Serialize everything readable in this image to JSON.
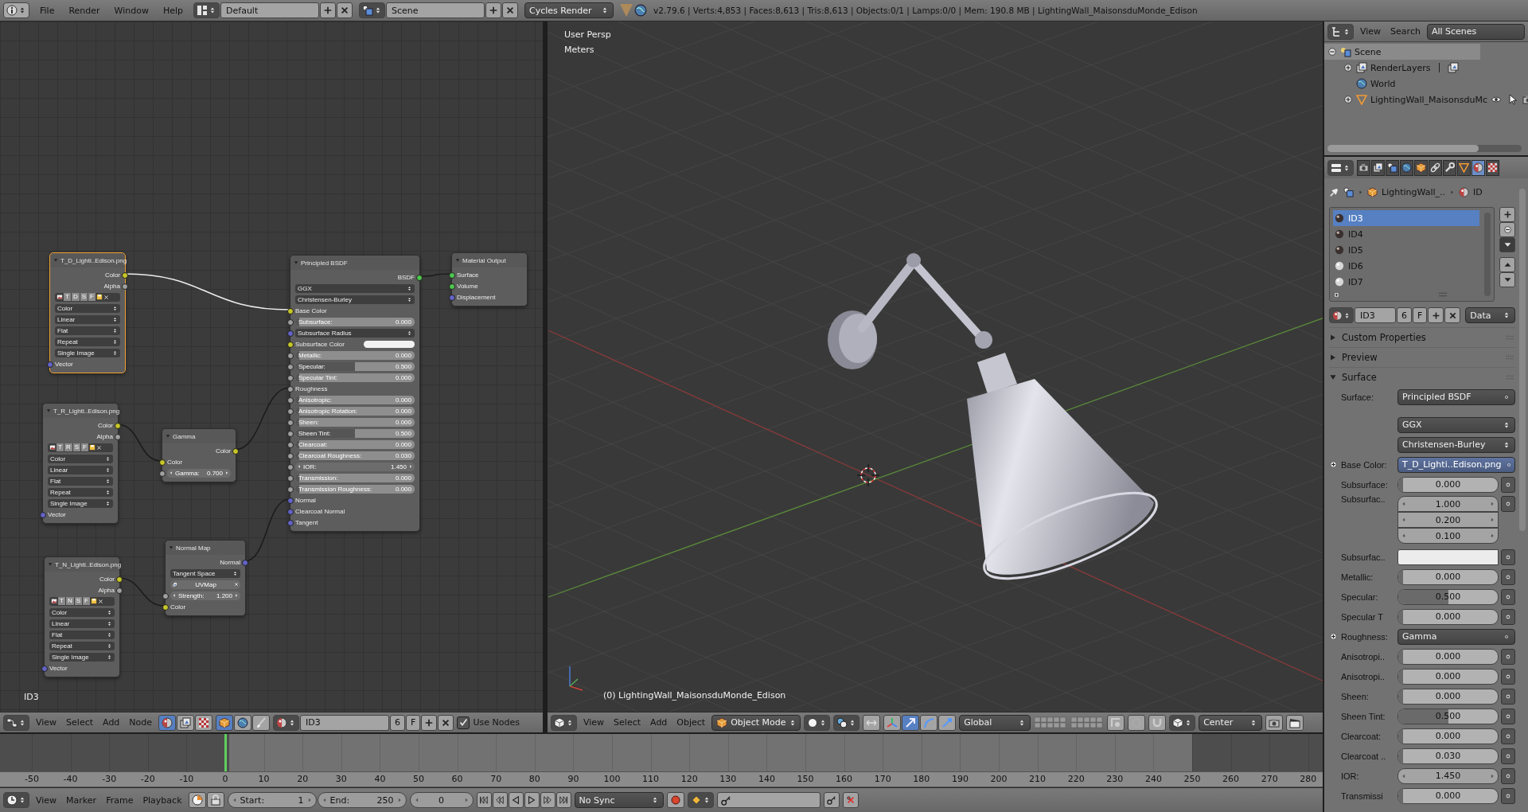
{
  "top_bar": {
    "menus": [
      "File",
      "Render",
      "Window",
      "Help"
    ],
    "screen_layout": "Default",
    "scene": "Scene",
    "engine": "Cycles Render",
    "stats": "v2.79.6 | Verts:4,853 | Faces:8,613 | Tris:8,613 | Objects:0/1 | Lamps:0/0 | Mem: 190.8 MB | LightingWall_MaisonsduMonde_Edison"
  },
  "node_editor": {
    "material_label": "ID3",
    "nodes": [
      {
        "title": "T_D_Lighti..Edison.png",
        "selected": true,
        "rows": [
          {
            "kind": "output",
            "label": "Color",
            "color": "#c7c729"
          },
          {
            "kind": "output",
            "label": "Alpha",
            "color": "#a1a1a1"
          },
          {
            "kind": "image_buttons",
            "letters": [
              "T",
              "D",
              "S",
              "F"
            ]
          },
          {
            "kind": "dropdown",
            "value": "Color"
          },
          {
            "kind": "dropdown",
            "value": "Linear"
          },
          {
            "kind": "dropdown",
            "value": "Flat"
          },
          {
            "kind": "dropdown",
            "value": "Repeat"
          },
          {
            "kind": "dropdown",
            "value": "Single Image"
          },
          {
            "kind": "input",
            "label": "Vector",
            "color": "#6363c7"
          }
        ]
      },
      {
        "title": "T_R_Lighti..Edison.png",
        "selected": false,
        "rows": [
          {
            "kind": "output",
            "label": "Color",
            "color": "#c7c729"
          },
          {
            "kind": "output",
            "label": "Alpha",
            "color": "#a1a1a1"
          },
          {
            "kind": "image_buttons",
            "letters": [
              "T",
              "R",
              "S",
              "F"
            ]
          },
          {
            "kind": "dropdown",
            "value": "Color"
          },
          {
            "kind": "dropdown",
            "value": "Linear"
          },
          {
            "kind": "dropdown",
            "value": "Flat"
          },
          {
            "kind": "dropdown",
            "value": "Repeat"
          },
          {
            "kind": "dropdown",
            "value": "Single Image"
          },
          {
            "kind": "input",
            "label": "Vector",
            "color": "#6363c7"
          }
        ]
      },
      {
        "title": "T_N_Lighti..Edison.png",
        "selected": false,
        "rows": [
          {
            "kind": "output",
            "label": "Color",
            "color": "#c7c729"
          },
          {
            "kind": "output",
            "label": "Alpha",
            "color": "#a1a1a1"
          },
          {
            "kind": "image_buttons",
            "letters": [
              "T",
              "N",
              "S",
              "F"
            ]
          },
          {
            "kind": "dropdown",
            "value": "Color"
          },
          {
            "kind": "dropdown",
            "value": "Linear"
          },
          {
            "kind": "dropdown",
            "value": "Flat"
          },
          {
            "kind": "dropdown",
            "value": "Repeat"
          },
          {
            "kind": "dropdown",
            "value": "Single Image"
          },
          {
            "kind": "input",
            "label": "Vector",
            "color": "#6363c7"
          }
        ]
      },
      {
        "title": "Gamma",
        "selected": false,
        "rows": [
          {
            "kind": "output",
            "label": "Color",
            "color": "#c7c729"
          },
          {
            "kind": "input",
            "label": "Color",
            "color": "#c7c729"
          },
          {
            "kind": "number",
            "label": "Gamma:",
            "value": "0.700",
            "color": "#a1a1a1"
          }
        ]
      },
      {
        "title": "Normal Map",
        "selected": false,
        "rows": [
          {
            "kind": "output",
            "label": "Normal",
            "color": "#6363c7"
          },
          {
            "kind": "dropdown",
            "value": "Tangent Space"
          },
          {
            "kind": "field",
            "value": "UVMap"
          },
          {
            "kind": "number",
            "label": "Strength:",
            "value": "1.200",
            "color": "#a1a1a1"
          },
          {
            "kind": "input",
            "label": "Color",
            "color": "#c7c729"
          }
        ]
      },
      {
        "title": "Principled BSDF",
        "selected": false,
        "rows": [
          {
            "kind": "output",
            "label": "BSDF",
            "color": "#4fc74f"
          },
          {
            "kind": "dropdown",
            "value": "GGX"
          },
          {
            "kind": "dropdown",
            "value": "Christensen-Burley"
          },
          {
            "kind": "input",
            "label": "Base Color",
            "color": "#c7c729"
          },
          {
            "kind": "slider",
            "label": "Subsurface:",
            "value": "0.000",
            "level": 0,
            "color": "#a1a1a1"
          },
          {
            "kind": "dropdown",
            "value": "Subsurface Radius",
            "color": "#6363c7"
          },
          {
            "kind": "color",
            "label": "Subsurface Color",
            "color": "#c7c729"
          },
          {
            "kind": "slider",
            "label": "Metallic:",
            "value": "0.000",
            "level": 0,
            "color": "#a1a1a1"
          },
          {
            "kind": "slider",
            "label": "Specular:",
            "value": "0.500",
            "level": 0.5,
            "color": "#a1a1a1"
          },
          {
            "kind": "slider",
            "label": "Specular Tint:",
            "value": "0.000",
            "level": 0,
            "color": "#a1a1a1"
          },
          {
            "kind": "input",
            "label": "Roughness",
            "color": "#a1a1a1"
          },
          {
            "kind": "slider",
            "label": "Anisotropic:",
            "value": "0.000",
            "level": 0,
            "color": "#a1a1a1"
          },
          {
            "kind": "slider",
            "label": "Anisotropic Rotation:",
            "value": "0.000",
            "level": 0,
            "color": "#a1a1a1"
          },
          {
            "kind": "slider",
            "label": "Sheen:",
            "value": "0.000",
            "level": 0,
            "color": "#a1a1a1"
          },
          {
            "kind": "slider",
            "label": "Sheen Tint:",
            "value": "0.500",
            "level": 0.5,
            "color": "#a1a1a1"
          },
          {
            "kind": "slider",
            "label": "Clearcoat:",
            "value": "0.000",
            "level": 0,
            "color": "#a1a1a1"
          },
          {
            "kind": "slider",
            "label": "Clearcoat Roughness:",
            "value": "0.030",
            "level": 0.03,
            "color": "#a1a1a1"
          },
          {
            "kind": "number",
            "label": "IOR:",
            "value": "1.450",
            "color": "#a1a1a1"
          },
          {
            "kind": "slider",
            "label": "Transmission:",
            "value": "0.000",
            "level": 0,
            "color": "#a1a1a1"
          },
          {
            "kind": "slider",
            "label": "Transmission Roughness:",
            "value": "0.000",
            "level": 0,
            "color": "#a1a1a1"
          },
          {
            "kind": "input",
            "label": "Normal",
            "color": "#6363c7"
          },
          {
            "kind": "input",
            "label": "Clearcoat Normal",
            "color": "#6363c7"
          },
          {
            "kind": "input",
            "label": "Tangent",
            "color": "#6363c7"
          }
        ]
      },
      {
        "title": "Material Output",
        "selected": false,
        "rows": [
          {
            "kind": "input",
            "label": "Surface",
            "color": "#4fc74f"
          },
          {
            "kind": "input",
            "label": "Volume",
            "color": "#4fc74f"
          },
          {
            "kind": "input",
            "label": "Displacement",
            "color": "#6363c7"
          }
        ]
      }
    ],
    "header": {
      "menus": [
        "View",
        "Select",
        "Add",
        "Node"
      ],
      "tree_types": [
        {
          "selected": true
        },
        {
          "selected": false
        },
        {
          "selected": false
        }
      ],
      "shader_sources": [
        {
          "selected": true
        },
        {
          "selected": false
        },
        {
          "selected": false
        }
      ],
      "material": "ID3",
      "users": "6",
      "fake_user": "F",
      "use_nodes": {
        "label": "Use Nodes",
        "checked": true
      }
    }
  },
  "viewport": {
    "view_name": "User Persp",
    "units": "Meters",
    "object_label": "(0) LightingWall_MaisonsduMonde_Edison",
    "header": {
      "menus": [
        "View",
        "Select",
        "Add",
        "Object"
      ],
      "mode": "Object Mode",
      "orientation": "Global",
      "pivot": "Center"
    }
  },
  "timeline": {
    "ruler": [
      "-50",
      "-40",
      "-30",
      "-20",
      "-10",
      "0",
      "10",
      "20",
      "30",
      "40",
      "50",
      "60",
      "70",
      "80",
      "90",
      "100",
      "110",
      "120",
      "130",
      "140",
      "150",
      "160",
      "170",
      "180",
      "190",
      "200",
      "210",
      "220",
      "230",
      "240",
      "250",
      "260",
      "270",
      "280"
    ],
    "header": {
      "menus": [
        "View",
        "Marker",
        "Frame",
        "Playback"
      ],
      "start_label": "Start:",
      "start": "1",
      "end_label": "End:",
      "end": "250",
      "current": "0",
      "sync": "No Sync"
    }
  },
  "outliner": {
    "header": {
      "menus": [
        "View",
        "Search"
      ],
      "display": "All Scenes"
    },
    "tree": [
      {
        "label": "Scene",
        "kind": "scene",
        "expanded": true,
        "selected": true,
        "children": [
          {
            "label": "RenderLayers",
            "kind": "render_layers",
            "expanded": false,
            "selected": false
          },
          {
            "label": "World",
            "kind": "world",
            "selected": false
          },
          {
            "label": "LightingWall_MaisonsduMc",
            "kind": "object",
            "expanded": false,
            "selected": false
          }
        ]
      }
    ]
  },
  "properties": {
    "tabs": [
      {
        "kind": "render",
        "selected": false
      },
      {
        "kind": "render_layers",
        "selected": false
      },
      {
        "kind": "scene",
        "selected": false
      },
      {
        "kind": "world",
        "selected": false
      },
      {
        "kind": "object",
        "selected": false
      },
      {
        "kind": "constraints",
        "selected": false
      },
      {
        "kind": "modifiers",
        "selected": false
      },
      {
        "kind": "data",
        "selected": false
      },
      {
        "kind": "material",
        "selected": true
      },
      {
        "kind": "texture",
        "selected": false
      }
    ],
    "breadcrumb": {
      "object": "LightingWall_..",
      "material": "ID"
    },
    "slots": [
      {
        "name": "ID3",
        "selected": true
      },
      {
        "name": "ID4",
        "selected": false
      },
      {
        "name": "ID5",
        "selected": false
      },
      {
        "name": "ID6",
        "selected": false
      },
      {
        "name": "ID7",
        "selected": false
      }
    ],
    "material_selector": {
      "name": "ID3",
      "users": "6",
      "fake_user": "F",
      "link": "Data"
    },
    "panels": [
      {
        "title": "Custom Properties",
        "expanded": false
      },
      {
        "title": "Preview",
        "expanded": false
      },
      {
        "title": "Surface",
        "expanded": true,
        "rows": [
          {
            "kind": "dropdown",
            "label": "Surface:",
            "value": "Principled BSDF"
          },
          {
            "kind": "select",
            "value": "GGX"
          },
          {
            "kind": "select",
            "value": "Christensen-Burley"
          },
          {
            "kind": "linked",
            "label": "Base Color:",
            "value": "T_D_Lighti..Edison.png",
            "highlighted": true
          },
          {
            "kind": "slider",
            "label": "Subsurface:",
            "value": "0.000",
            "level": 0
          },
          {
            "kind": "vector",
            "label": "Subsurfac..",
            "values": [
              "1.000",
              "0.200",
              "0.100"
            ]
          },
          {
            "kind": "color",
            "label": "Subsurfac.."
          },
          {
            "kind": "slider",
            "label": "Metallic:",
            "value": "0.000",
            "level": 0
          },
          {
            "kind": "slider",
            "label": "Specular:",
            "value": "0.500",
            "level": 0.5
          },
          {
            "kind": "slider",
            "label": "Specular T",
            "value": "0.000",
            "level": 0
          },
          {
            "kind": "linked",
            "label": "Roughness:",
            "value": "Gamma",
            "highlighted": false
          },
          {
            "kind": "slider",
            "label": "Anisotropi..",
            "value": "0.000",
            "level": 0
          },
          {
            "kind": "slider",
            "label": "Anisotropi..",
            "value": "0.000",
            "level": 0
          },
          {
            "kind": "slider",
            "label": "Sheen:",
            "value": "0.000",
            "level": 0
          },
          {
            "kind": "slider",
            "label": "Sheen Tint:",
            "value": "0.500",
            "level": 0.5
          },
          {
            "kind": "slider",
            "label": "Clearcoat:",
            "value": "0.000",
            "level": 0
          },
          {
            "kind": "slider",
            "label": "Clearcoat ..",
            "value": "0.030",
            "level": 0.03
          },
          {
            "kind": "number",
            "label": "IOR:",
            "value": "1.450"
          },
          {
            "kind": "slider",
            "label": "Transmissi",
            "value": "0.000",
            "level": 0
          }
        ]
      }
    ]
  }
}
